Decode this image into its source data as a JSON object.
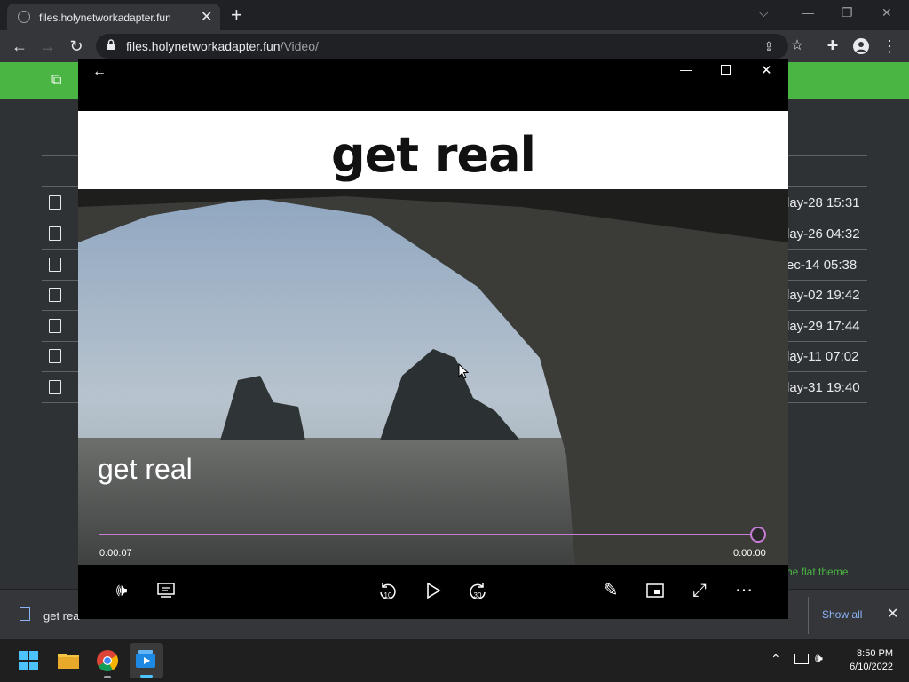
{
  "browser": {
    "tab_title": "files.holynetworkadapter.fun",
    "url_host": "files.holynetworkadapter.fun",
    "url_path": "/Video/"
  },
  "page": {
    "rows": [
      {
        "date": "lay-28 15:31"
      },
      {
        "date": "lay-26 04:32"
      },
      {
        "date": "ec-14 05:38"
      },
      {
        "date": "lay-02 19:42"
      },
      {
        "date": "lay-29 17:44"
      },
      {
        "date": "lay-11 07:02"
      },
      {
        "date": "lay-31 19:40"
      }
    ],
    "footer_text": "he flat theme."
  },
  "downloads": {
    "item_name": "get rea",
    "show_all": "Show all"
  },
  "player": {
    "banner_text": "get real",
    "caption": "get real",
    "elapsed": "0:00:07",
    "remaining": "0:00:00",
    "progress": 1.0,
    "accent": "#c77dd6"
  },
  "taskbar": {
    "time": "8:50 PM",
    "date": "6/10/2022"
  }
}
